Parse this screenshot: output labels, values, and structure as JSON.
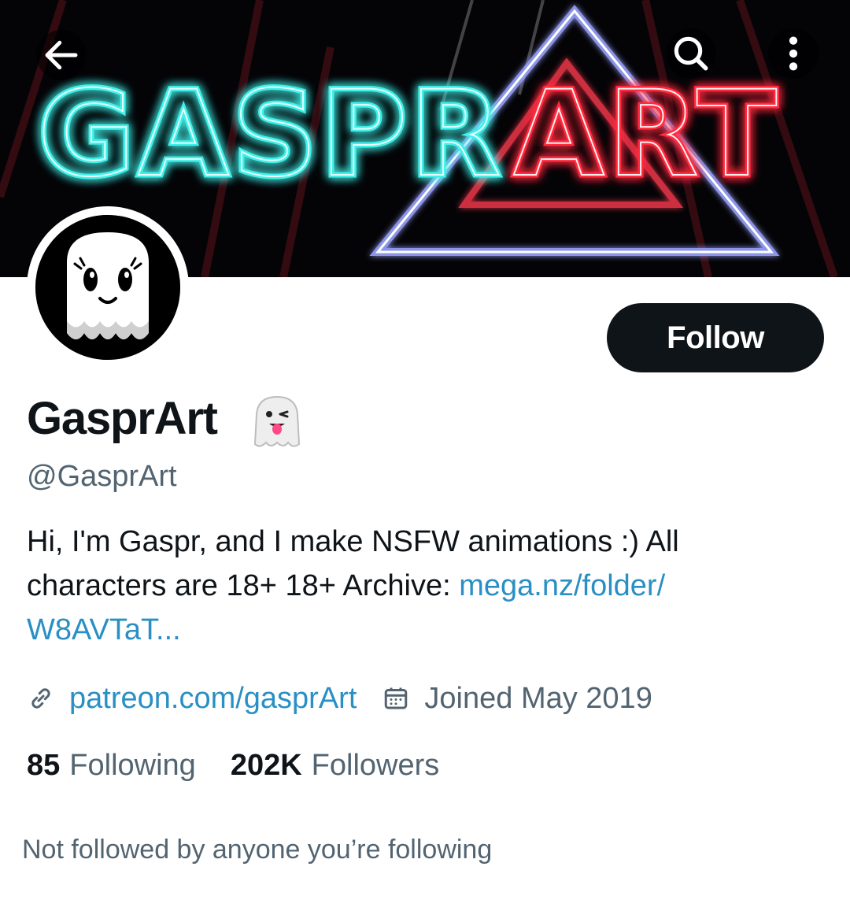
{
  "banner": {
    "title_left": "GASPR",
    "title_right": "ART"
  },
  "profile": {
    "display_name": "GasprArt",
    "handle": "@GasprArt",
    "bio_text": "Hi, I'm Gaspr, and I make NSFW animations :) All characters are 18+ 18+ Archive: ",
    "bio_link": "mega.nz/folder/​W8AVTaT...",
    "website": "patreon.com/gasprArt",
    "joined": "Joined May 2019"
  },
  "actions": {
    "follow_label": "Follow"
  },
  "stats": {
    "following_count": "85",
    "following_label": "Following",
    "followers_count": "202K",
    "followers_label": "Followers"
  },
  "footer": {
    "not_followed": "Not followed by anyone you’re following"
  },
  "icons": {
    "back": "back-arrow-icon",
    "search": "search-icon",
    "more": "more-vertical-icon",
    "link": "link-icon",
    "calendar": "calendar-icon"
  },
  "colors": {
    "link": "#2a8fc4",
    "button": "#0f1419",
    "secondary_text": "#536471",
    "banner_cyan": "#3ff0e8",
    "banner_red": "#ff2b3e"
  }
}
